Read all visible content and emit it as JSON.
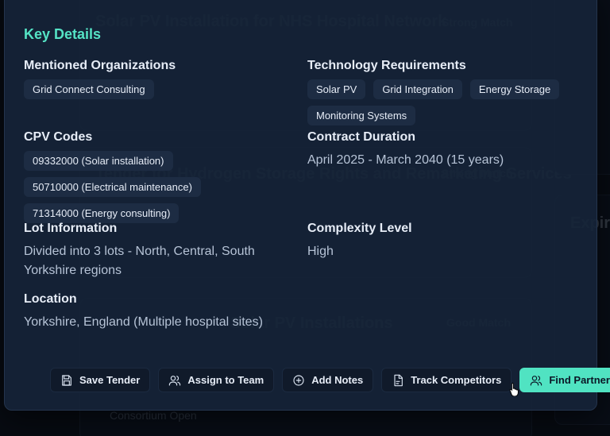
{
  "background": {
    "cards": [
      {
        "title": "Solar PV Installation for NHS Hospital Network",
        "badge": "Strong Match"
      },
      {
        "title": "Tender for Hydrogen Storage Rights and Remarketing Services",
        "badge": "Strong Match"
      },
      {
        "title": "Solar PV Installations",
        "badge": "Good Match"
      }
    ],
    "consortium_label": "Consortium Open",
    "side_title": "Expiring"
  },
  "modal": {
    "section_title": "Key Details",
    "mentioned_orgs": {
      "label": "Mentioned Organizations",
      "items": [
        "Grid Connect Consulting"
      ]
    },
    "tech_requirements": {
      "label": "Technology Requirements",
      "items": [
        "Solar PV",
        "Grid Integration",
        "Energy Storage",
        "Monitoring Systems"
      ]
    },
    "cpv_codes": {
      "label": "CPV Codes",
      "items": [
        "09332000 (Solar installation)",
        "50710000 (Electrical maintenance)",
        "71314000 (Energy consulting)"
      ]
    },
    "contract_duration": {
      "label": "Contract Duration",
      "value": "April 2025 - March 2040 (15 years)"
    },
    "lot_info": {
      "label": "Lot Information",
      "value": "Divided into 3 lots - North, Central, South Yorkshire regions"
    },
    "complexity": {
      "label": "Complexity Level",
      "value": "High"
    },
    "location": {
      "label": "Location",
      "value": "Yorkshire, England (Multiple hospital sites)"
    }
  },
  "actions": {
    "save": {
      "label": "Save Tender",
      "icon": "save-icon"
    },
    "assign": {
      "label": "Assign to Team",
      "icon": "users-icon"
    },
    "notes": {
      "label": "Add Notes",
      "icon": "plus-circle-icon"
    },
    "track": {
      "label": "Track Competitors",
      "icon": "document-icon"
    },
    "partners": {
      "label": "Find Partners",
      "icon": "users-icon"
    }
  },
  "colors": {
    "accent": "#50e3c2",
    "title_accent": "#55e3c5",
    "modal_bg": "#162438"
  }
}
